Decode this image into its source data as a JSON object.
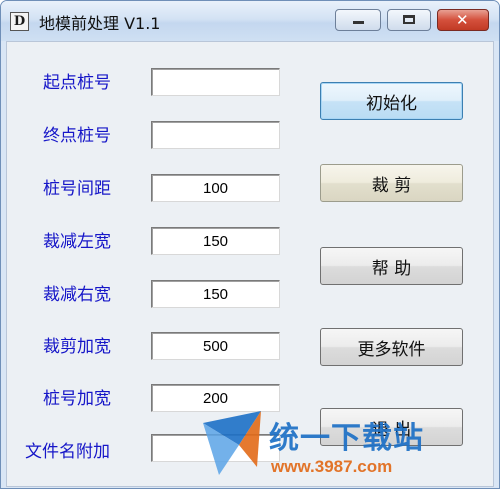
{
  "window": {
    "icon_letter": "D",
    "title": "地模前处理 V1.1"
  },
  "form": {
    "fields": [
      {
        "label": "起点桩号",
        "value": ""
      },
      {
        "label": "终点桩号",
        "value": ""
      },
      {
        "label": "桩号间距",
        "value": "100"
      },
      {
        "label": "裁减左宽",
        "value": "150"
      },
      {
        "label": "裁减右宽",
        "value": "150"
      },
      {
        "label": "裁剪加宽",
        "value": "500"
      },
      {
        "label": "桩号加宽",
        "value": "200"
      },
      {
        "label": "文件名附加",
        "value": ""
      }
    ]
  },
  "buttons": {
    "init": "初始化",
    "crop": "裁 剪",
    "help": "帮 助",
    "more": "更多软件",
    "exit": "退 出"
  },
  "watermark": {
    "brand": "统一下载站",
    "url": "www.3987.com"
  },
  "colors": {
    "label": "#1616c8",
    "title_bar": "#d3e2f4",
    "close_button": "#c13a25",
    "watermark_blue": "#1d70c6",
    "watermark_orange": "#e26a18"
  }
}
